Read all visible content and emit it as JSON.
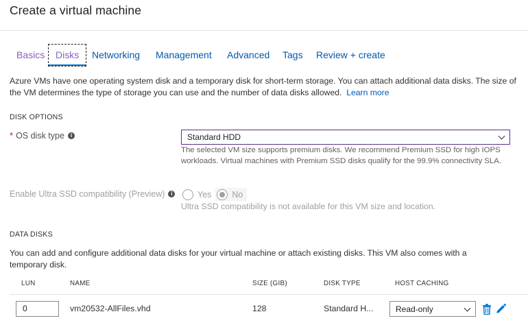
{
  "page": {
    "title": "Create a virtual machine"
  },
  "tabs": [
    {
      "label": "Basics",
      "state": "visited"
    },
    {
      "label": "Disks",
      "state": "active"
    },
    {
      "label": "Networking",
      "state": "normal"
    },
    {
      "label": "Management",
      "state": "normal"
    },
    {
      "label": "Advanced",
      "state": "normal"
    },
    {
      "label": "Tags",
      "state": "normal"
    },
    {
      "label": "Review + create",
      "state": "normal"
    }
  ],
  "intro": {
    "text": "Azure VMs have one operating system disk and a temporary disk for short-term storage. You can attach additional data disks. The size of the VM determines the type of storage you can use and the number of data disks allowed.",
    "link": "Learn more"
  },
  "disk_options": {
    "heading": "DISK OPTIONS",
    "os_disk_type": {
      "required_mark": "*",
      "label": "OS disk type",
      "value": "Standard HDD",
      "help": "The selected VM size supports premium disks. We recommend Premium SSD for high IOPS workloads. Virtual machines with Premium SSD disks qualify for the 99.9% connectivity SLA."
    },
    "ultra_ssd": {
      "label": "Enable Ultra SSD compatibility (Preview)",
      "options": [
        "Yes",
        "No"
      ],
      "selected": "No",
      "help": "Ultra SSD compatibility is not available for this VM size and location."
    }
  },
  "data_disks": {
    "heading": "DATA DISKS",
    "description": "You can add and configure additional data disks for your virtual machine or attach existing disks. This VM also comes with a temporary disk.",
    "columns": [
      "LUN",
      "NAME",
      "SIZE (GIB)",
      "DISK TYPE",
      "HOST CACHING"
    ],
    "rows": [
      {
        "lun": "0",
        "name": "vm20532-AllFiles.vhd",
        "size": "128",
        "disk_type": "Standard H...",
        "host_caching": "Read-only"
      }
    ]
  },
  "icons": {
    "info": "info-icon",
    "delete": "trash-icon",
    "edit": "pencil-icon",
    "dropdown": "chevron-down-icon"
  },
  "colors": {
    "link": "#0058ad",
    "visited": "#8661c5",
    "required": "#a4262c",
    "select_focus": "#5c2d91",
    "icon_blue": "#0078d4"
  }
}
